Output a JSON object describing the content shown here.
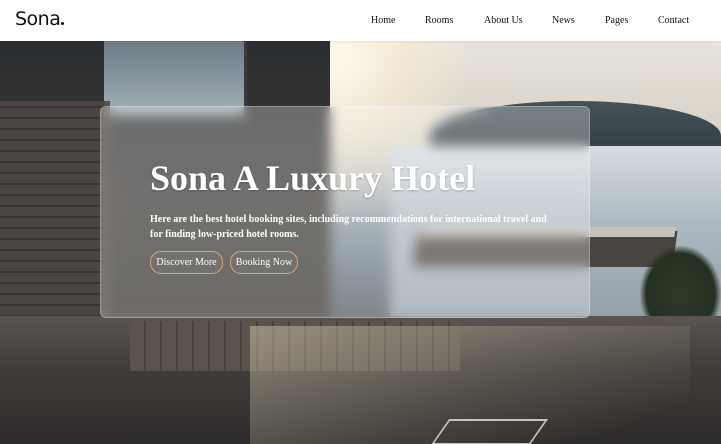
{
  "brand": {
    "logo_text": "Sona"
  },
  "nav": {
    "items": [
      {
        "label": "Home"
      },
      {
        "label": "Rooms"
      },
      {
        "label": "About Us"
      },
      {
        "label": "News"
      },
      {
        "label": "Pages"
      },
      {
        "label": "Contact"
      }
    ]
  },
  "hero": {
    "title": "Sona A Luxury Hotel",
    "description": "Here are the best hotel booking sites, including recommendations for international travel and for finding low-priced hotel rooms.",
    "buttons": {
      "discover_label": "Discover More",
      "booking_label": "Booking Now"
    }
  },
  "colors": {
    "button_border": "#d9a56d",
    "nav_text": "#111111",
    "hero_text": "#ffffff"
  }
}
